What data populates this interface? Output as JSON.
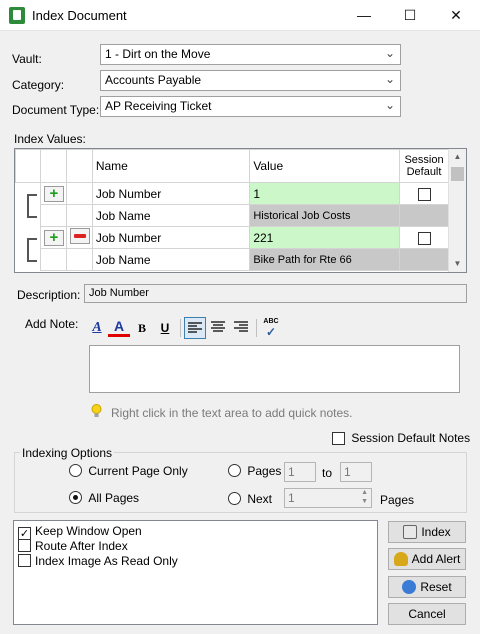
{
  "window": {
    "title": "Index Document",
    "minimize_icon": "—",
    "maximize_icon": "☐",
    "close_icon": "✕"
  },
  "form": {
    "vault_label": "Vault:",
    "vault_value": "1 - Dirt on the Move",
    "category_label": "Category:",
    "category_value": "Accounts Payable",
    "doctype_label": "Document Type:",
    "doctype_value": "AP Receiving Ticket"
  },
  "index_values": {
    "label": "Index Values:",
    "headers": {
      "name": "Name",
      "value": "Value",
      "session": "Session Default"
    },
    "rows": [
      {
        "name": "Job Number",
        "value": "1",
        "checked": false
      },
      {
        "name": "Job Name",
        "value": "Historical Job Costs"
      },
      {
        "name": "Job Number",
        "value": "221",
        "checked": false
      },
      {
        "name": "Job Name",
        "value": "Bike Path for Rte 66"
      }
    ]
  },
  "description": {
    "label": "Description:",
    "value": "Job Number"
  },
  "note": {
    "label": "Add Note:",
    "hint": "Right click in the text area to add quick notes.",
    "bold": "B",
    "underline": "U",
    "spell": "ABC",
    "session_default_label": "Session Default Notes"
  },
  "indexing_options": {
    "legend": "Indexing Options",
    "current_page_label": "Current Page Only",
    "all_pages_label": "All Pages",
    "pages_label": "Pages",
    "pages_from": "1",
    "pages_to_label": "to",
    "pages_to": "1",
    "next_label": "Next",
    "next_value": "1",
    "next_suffix": "Pages"
  },
  "options": [
    {
      "label": "Keep Window Open",
      "checked": true
    },
    {
      "label": "Route After Index",
      "checked": false
    },
    {
      "label": "Index Image As Read Only",
      "checked": false
    }
  ],
  "buttons": {
    "index": "Index",
    "add_alert": "Add Alert",
    "reset": "Reset",
    "cancel": "Cancel"
  },
  "colors": {
    "value_green": "#ccf7c9",
    "value_gray": "#c8c8c8",
    "plus_green": "#1b9e1b",
    "minus_red": "#dd2222"
  }
}
